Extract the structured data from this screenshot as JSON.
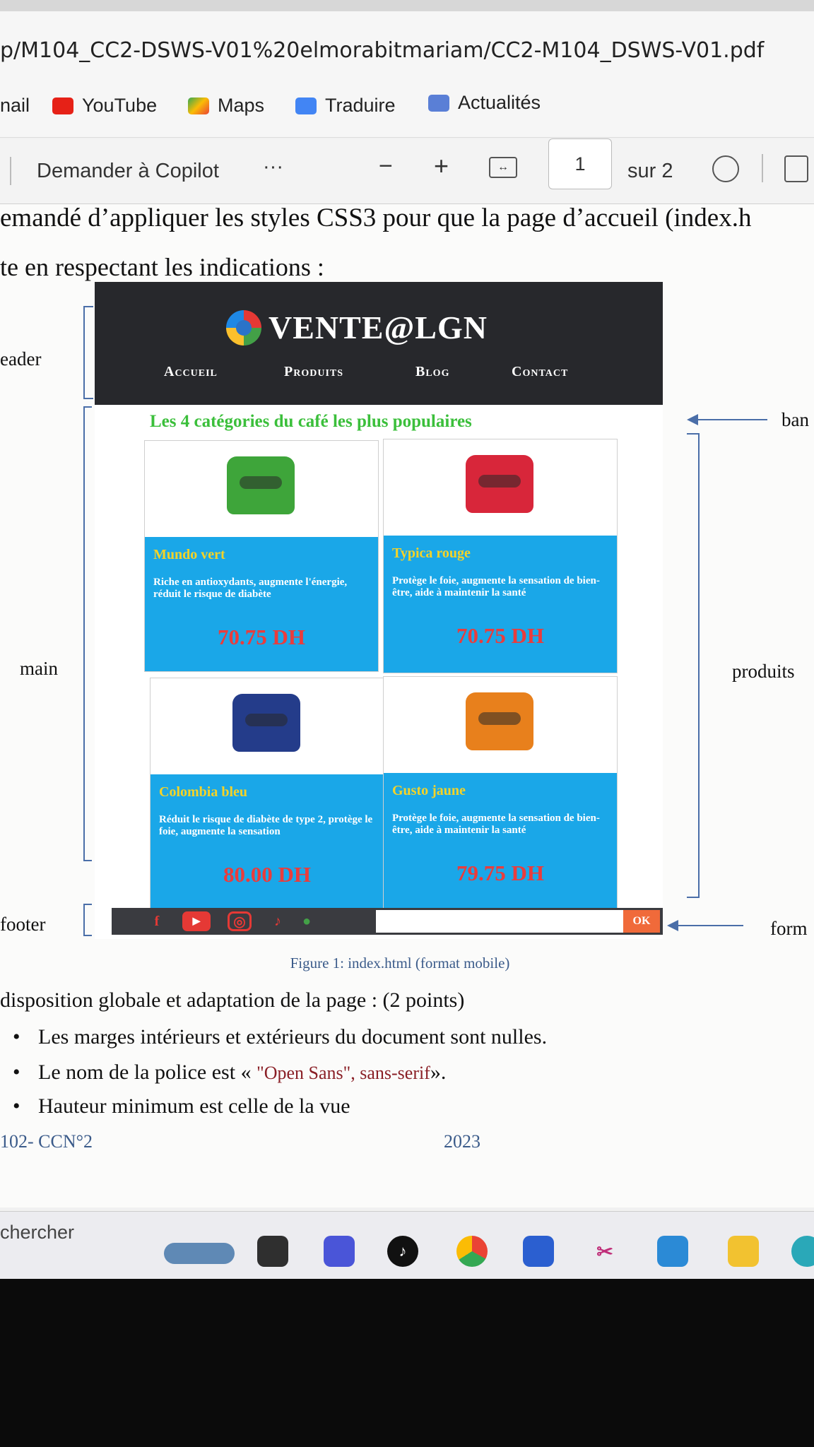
{
  "browser": {
    "url": "p/M104_CC2-DSWS-V01%20elmorabitmariam/CC2-M104_DSWS-V01.pdf",
    "bookmarks": [
      {
        "label": "nail",
        "icon": "gmail-icon"
      },
      {
        "label": "YouTube",
        "icon": "youtube-icon"
      },
      {
        "label": "Maps",
        "icon": "maps-icon"
      },
      {
        "label": "Traduire",
        "icon": "translate-icon"
      },
      {
        "label": "Actualités",
        "icon": "news-icon"
      }
    ]
  },
  "pdf_toolbar": {
    "copilot": "Demander à Copilot",
    "more": "···",
    "zoom_out": "−",
    "zoom_in": "+",
    "page": "1",
    "page_total": "sur 2"
  },
  "document": {
    "line1": "emandé d’appliquer les styles CSS3 pour que la page d’accueil (index.h",
    "line2": "te en respectant les indications :",
    "labels": {
      "header": "eader",
      "main": "main",
      "footer": "footer",
      "banner": "ban",
      "produits": "produits",
      "form": "form"
    },
    "mockup": {
      "logo": "VENTE@LGN",
      "nav": [
        "Accueil",
        "Produits",
        "Blog",
        "Contact"
      ],
      "banner": "Les 4 catégories du café les plus populaires",
      "products": [
        {
          "name": "Mundo vert",
          "desc": "Riche en antioxydants, augmente l'énergie, réduit le risque de diabète",
          "price": "70.75 DH",
          "color": "#3ea53a"
        },
        {
          "name": "Typica rouge",
          "desc": "Protège le foie, augmente la sensation de bien-être, aide à maintenir la santé",
          "price": "70.75 DH",
          "color": "#d8263a"
        },
        {
          "name": "Colombia bleu",
          "desc": "Réduit le risque de diabète de type 2, protège le foie, augmente la sensation",
          "price": "80.00 DH",
          "color": "#243c8a"
        },
        {
          "name": "Gusto jaune",
          "desc": "Protège le foie, augmente la sensation de bien-être, aide à maintenir la santé",
          "price": "79.75 DH",
          "color": "#e8801c"
        }
      ],
      "social": [
        "f",
        "▶",
        "◎",
        "♪",
        "●"
      ],
      "ok": "OK"
    },
    "caption": "Figure 1: index.html (format mobile)",
    "question": "disposition globale et adaptation de la page : (2 points)",
    "bullets": [
      {
        "text": "Les marges intérieurs et extérieurs du document sont nulles."
      },
      {
        "prefix": "Le nom de la police est « ",
        "code": "\"Open Sans\", sans-serif",
        "suffix": "»."
      },
      {
        "text": "Hauteur minimum est celle de la vue"
      }
    ],
    "footer_left": "102- CCN°2",
    "footer_right": "2023"
  },
  "taskbar": {
    "search": "chercher"
  }
}
